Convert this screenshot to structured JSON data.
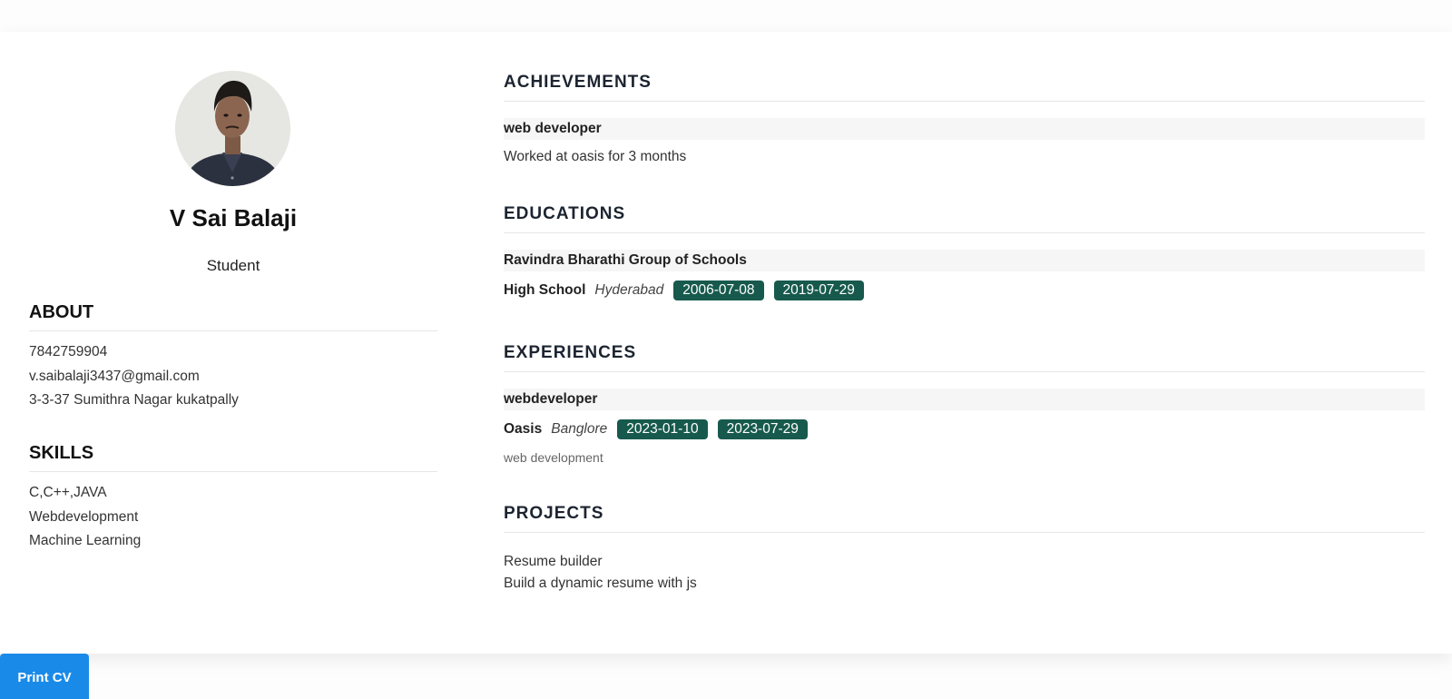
{
  "profile": {
    "name": "V Sai Balaji",
    "role": "Student"
  },
  "about": {
    "heading": "ABOUT",
    "items": [
      "7842759904",
      "v.saibalaji3437@gmail.com",
      "3-3-37 Sumithra Nagar kukatpally"
    ]
  },
  "skills": {
    "heading": "SKILLS",
    "items": [
      "C,C++,JAVA",
      "Webdevelopment",
      "Machine Learning"
    ]
  },
  "achievements": {
    "heading": "ACHIEVEMENTS",
    "title": "web developer",
    "description": "Worked at oasis for 3 months"
  },
  "educations": {
    "heading": "EDUCATIONS",
    "school": "Ravindra Bharathi Group of Schools",
    "level": "High School",
    "city": "Hyderabad",
    "start": "2006-07-08",
    "end": "2019-07-29"
  },
  "experiences": {
    "heading": "EXPERIENCES",
    "title": "webdeveloper",
    "company": "Oasis",
    "city": "Banglore",
    "start": "2023-01-10",
    "end": "2023-07-29",
    "description": "web development"
  },
  "projects": {
    "heading": "PROJECTS",
    "name": "Resume builder",
    "description": "Build a dynamic resume with js"
  },
  "actions": {
    "print_label": "Print CV"
  },
  "colors": {
    "accent": "#175a4d",
    "button": "#1a8ae8"
  }
}
